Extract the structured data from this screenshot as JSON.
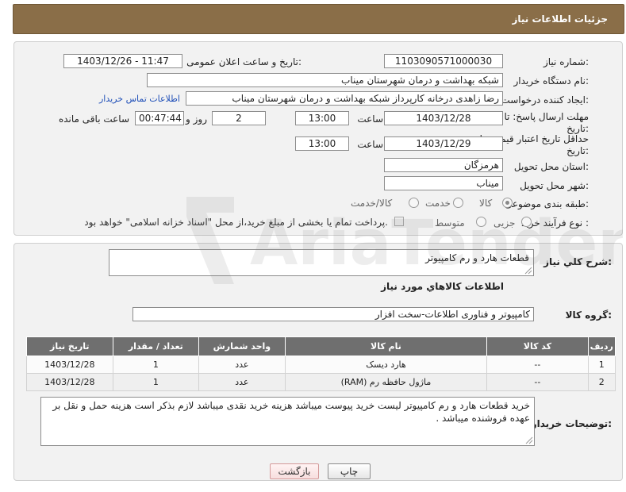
{
  "header": {
    "title": "جزئیات اطلاعات نیاز"
  },
  "info": {
    "need_number_label": "شماره نیاز:",
    "need_number": "1103090571000030",
    "announce_label": "تاریخ و ساعت اعلان عمومی:",
    "announce_value": "1403/12/26 - 11:47",
    "buyer_org_label": "نام دستگاه خریدار:",
    "buyer_org": "شبکه بهداشت و درمان شهرستان میناب",
    "creator_label": "ایجاد کننده درخواست:",
    "creator": "رضا زاهدی درخانه کارپرداز شبکه بهداشت و درمان شهرستان میناب",
    "contact_link": "اطلاعات تماس خریدار",
    "reply_deadline_label_1": "مهلت ارسال پاسخ: تا",
    "reply_deadline_label_2": "تاریخ:",
    "reply_date": "1403/12/28",
    "time_label": "ساعت",
    "reply_time": "13:00",
    "days_value": "2",
    "days_label": "روز و",
    "remaining_time": "00:47:44",
    "remaining_label": "ساعت باقی مانده",
    "price_validity_label_1": "حداقل تاریخ اعتبار قیمت: تا",
    "price_validity_label_2": "تاریخ:",
    "price_date": "1403/12/29",
    "price_time": "13:00",
    "province_label": "استان محل تحویل:",
    "province": "هرمزگان",
    "city_label": "شهر محل تحویل:",
    "city": "میناب",
    "category_label": "طبقه بندی موضوعی:",
    "category_options": [
      "کالا",
      "خدمت",
      "کالا/خدمت"
    ],
    "process_label": "نوع فرآیند خرید :",
    "process_options": [
      "جزیی",
      "متوسط"
    ],
    "payment_note": "پرداخت تمام یا بخشی از مبلغ خرید،از محل \"اسناد خزانه اسلامی\" خواهد بود."
  },
  "desc": {
    "summary_label": "شرح كلي نياز:",
    "summary": "قطعات هارد و رم کامپیوتر",
    "goods_info_title": "اطلاعات كالاهاي مورد نياز",
    "group_label": "گروه كالا:",
    "group": "کامپیوتر و فناوری اطلاعات-سخت افزار"
  },
  "table": {
    "headers": [
      "ردیف",
      "کد کالا",
      "نام کالا",
      "واحد شمارش",
      "تعداد / مقدار",
      "تاریخ نیاز"
    ],
    "rows": [
      [
        "1",
        "--",
        "هارد دیسک",
        "عدد",
        "1",
        "1403/12/28"
      ],
      [
        "2",
        "--",
        "ماژول حافظه رم (RAM)",
        "عدد",
        "1",
        "1403/12/28"
      ]
    ]
  },
  "buyer_notes": {
    "label": "توضیحات خریدار:",
    "text": "خرید قطعات هارد و رم کامپیوتر لیست خرید پیوست میباشد هزینه خرید نقدی میباشد لازم بذکر است  هزینه حمل و نقل بر عهده فروشنده میباشد ."
  },
  "buttons": {
    "print": "چاپ",
    "back": "بازگشت"
  },
  "watermark": {
    "text": "AriaTender.neT"
  }
}
